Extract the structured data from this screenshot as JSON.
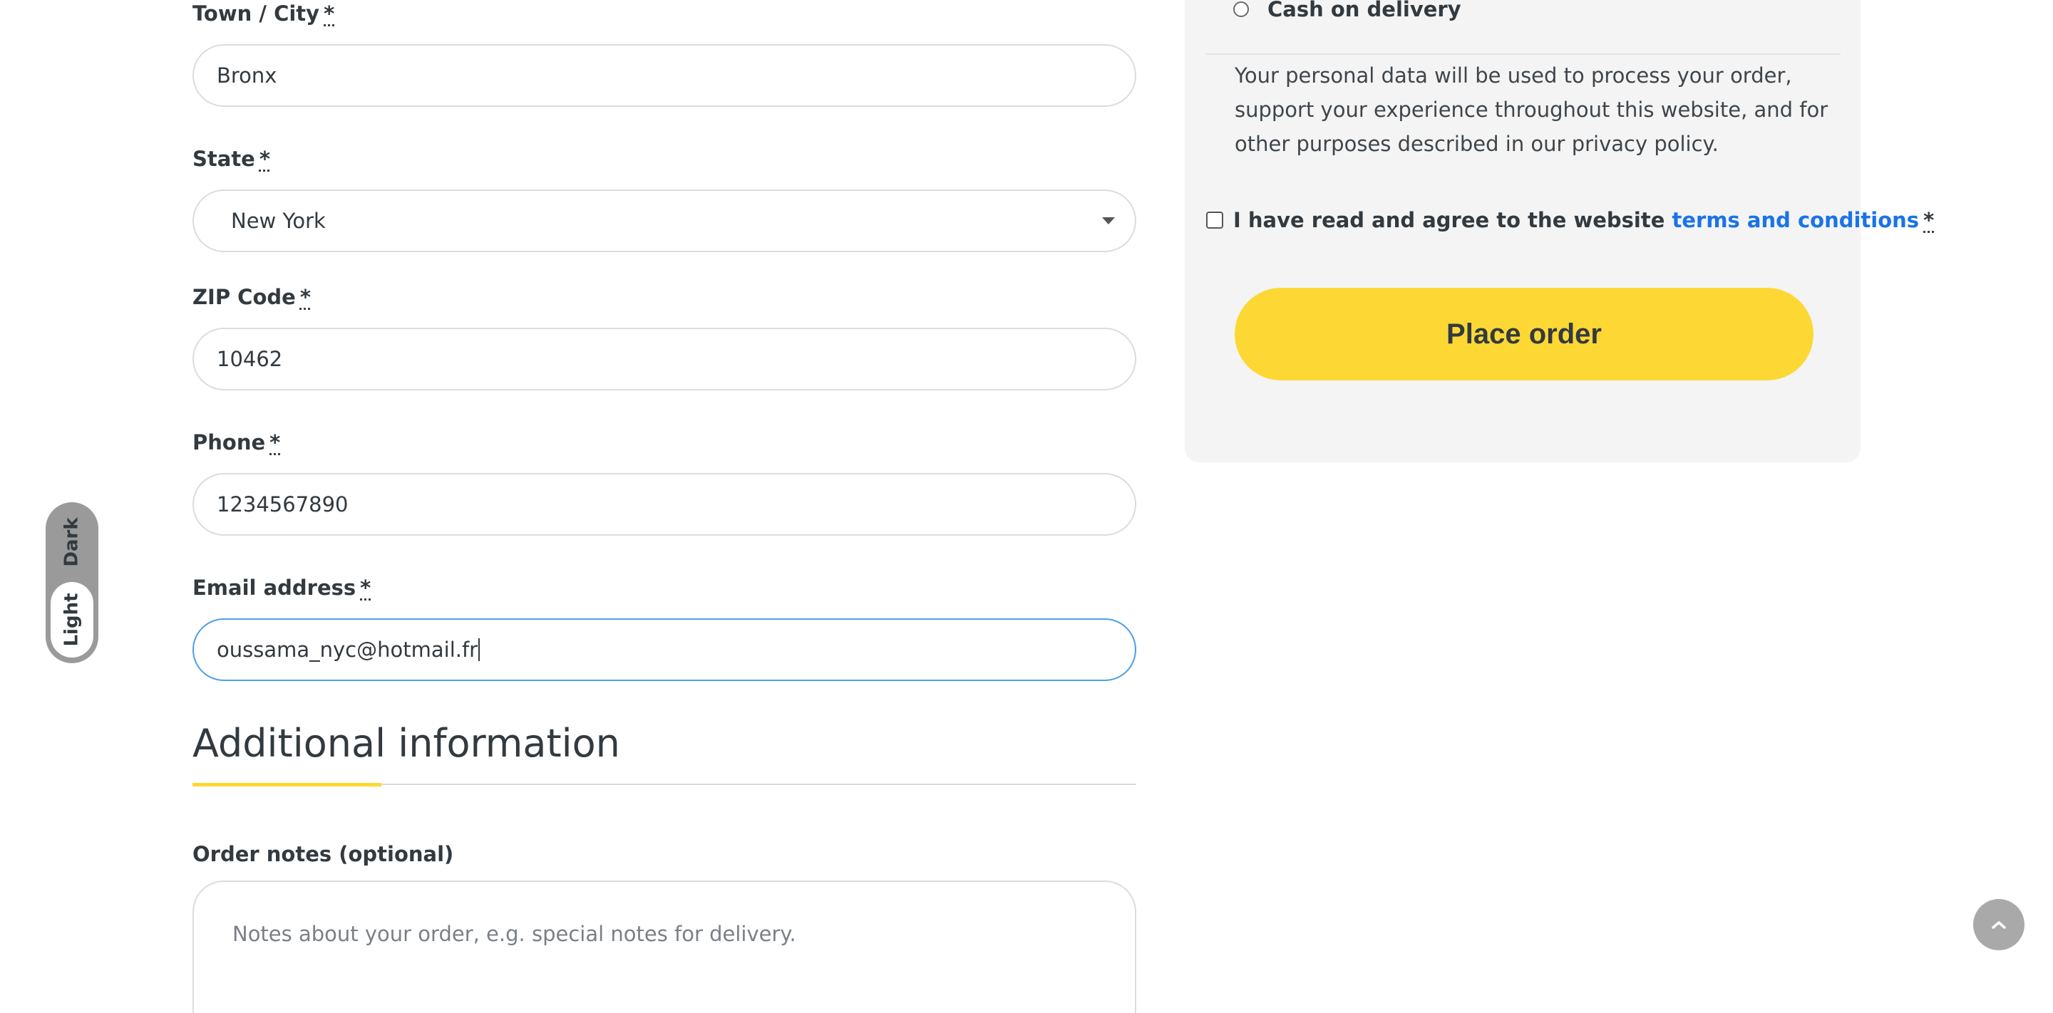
{
  "billing": {
    "town": {
      "label": "Town / City",
      "required": "*",
      "value": "Bronx"
    },
    "state": {
      "label": "State",
      "required": "*",
      "value": "New York"
    },
    "zip": {
      "label": "ZIP Code",
      "required": "*",
      "value": "10462"
    },
    "phone": {
      "label": "Phone",
      "required": "*",
      "value": "1234567890"
    },
    "email": {
      "label": "Email address",
      "required": "*",
      "value": "oussama_nyc@hotmail.fr"
    }
  },
  "additional": {
    "title": "Additional information",
    "notes_label": "Order notes (optional)",
    "notes_placeholder": "Notes about your order, e.g. special notes for delivery."
  },
  "summary": {
    "payment_option": "Cash on delivery",
    "privacy_text": "Your personal data will be used to process your order, support your experience throughout this website, and for other purposes described in our privacy policy.",
    "terms_prefix": "I have read and agree to the website ",
    "terms_link": "terms and conditions",
    "terms_required": "*",
    "place_order_label": "Place order"
  },
  "theme_toggle": {
    "dark_label": "Dark",
    "light_label": "Light"
  },
  "colors": {
    "accent_yellow": "#fdd835",
    "link_blue": "#1a73e8",
    "focus_blue": "#4c9ee8",
    "summary_bg": "#f4f4f4"
  },
  "icons": {
    "select_arrow": "caret-down-icon",
    "scroll_top": "chevron-up-icon"
  }
}
